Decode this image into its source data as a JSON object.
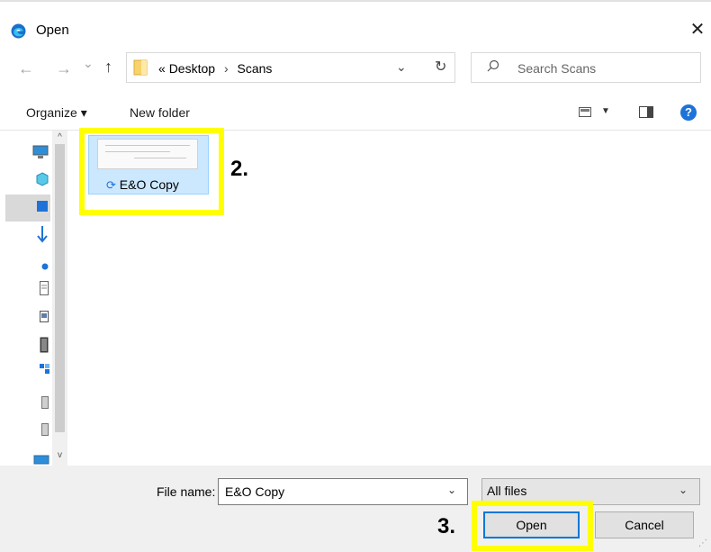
{
  "window": {
    "title": "Open",
    "close_glyph": "✕"
  },
  "nav": {
    "back_glyph": "←",
    "forward_glyph": "→",
    "recent_glyph": "⌄",
    "up_glyph": "↑",
    "address_prefix": "«",
    "breadcrumb": [
      "Desktop",
      "Scans"
    ],
    "breadcrumb_sep": "›",
    "address_dropdown_glyph": "⌄",
    "refresh_glyph": "↻",
    "search_placeholder": "Search Scans"
  },
  "toolbar": {
    "organize_label": "Organize ▾",
    "new_folder_label": "New folder",
    "view_dropdown_glyph": "▼",
    "help_glyph": "?"
  },
  "sidebar": {
    "scroll_up_glyph": "^",
    "scroll_down_glyph": "v",
    "icons": [
      "computer-icon",
      "3d-objects-icon",
      "desktop-icon",
      "downloads-icon",
      "onedrive-icon",
      "documents-icon",
      "pictures-icon",
      "videos-icon",
      "music-icon",
      "drive-icon",
      "drive-icon",
      "network-icon"
    ]
  },
  "files": [
    {
      "name": "E&O Copy",
      "sync_glyph": "⟳",
      "selected": true
    }
  ],
  "annotations": {
    "step2": "2.",
    "step3": "3.",
    "highlight_color": "#ffff00"
  },
  "bottom": {
    "file_name_label": "File name:",
    "file_name_value": "E&O Copy",
    "file_name_dropdown_glyph": "⌄",
    "filter_value": "All files",
    "filter_dropdown_glyph": "⌄",
    "open_label": "Open",
    "cancel_label": "Cancel",
    "grip_glyph": "⋰"
  },
  "colors": {
    "accent": "#0078d7",
    "selection": "#cce8ff",
    "help": "#1e73d8"
  }
}
